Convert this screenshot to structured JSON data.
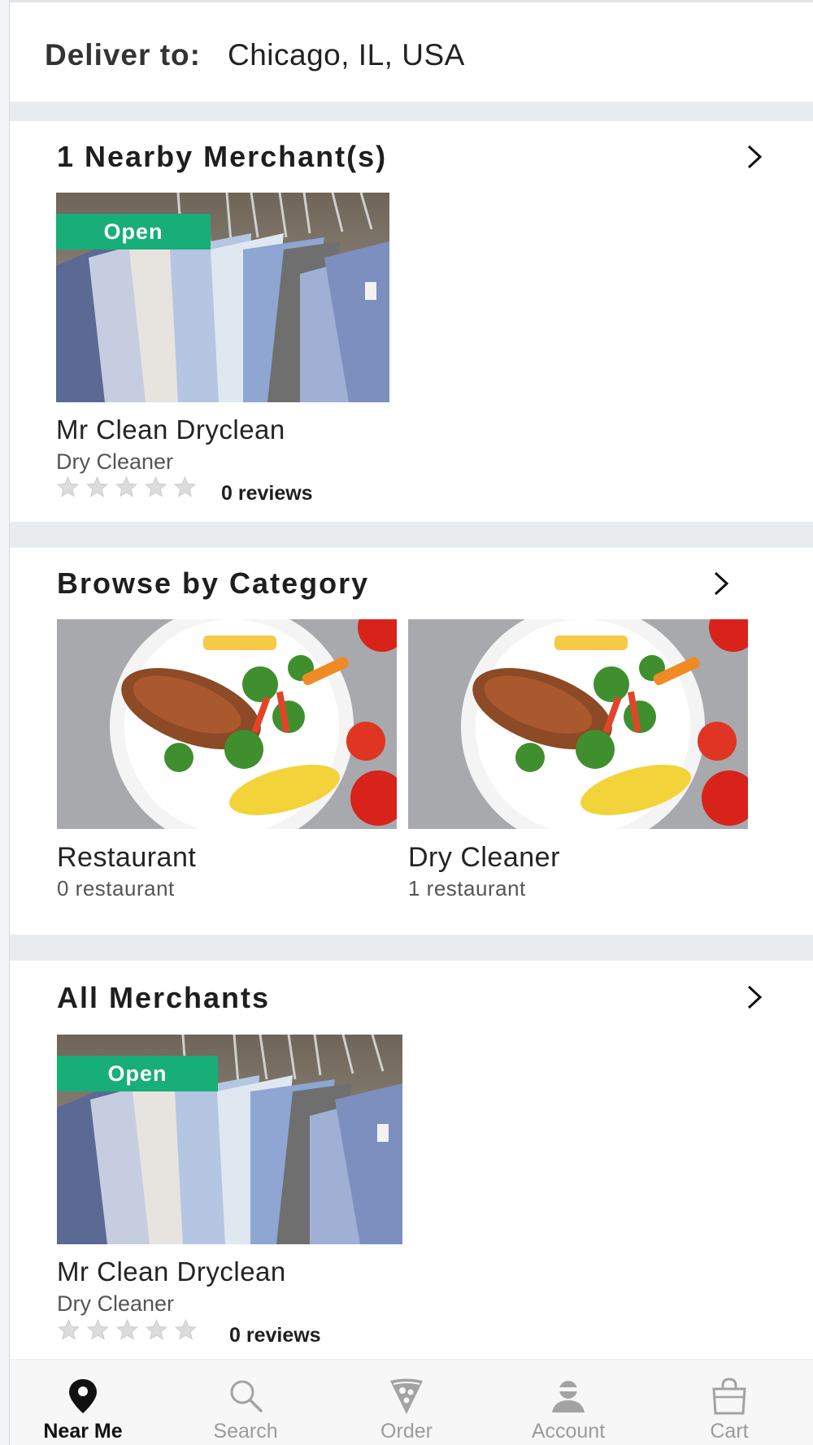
{
  "header": {
    "deliver_label": "Deliver to:",
    "location": "Chicago, IL, USA"
  },
  "nearby": {
    "title": "1 Nearby Merchant(s)",
    "merchant": {
      "badge": "Open",
      "name": "Mr Clean Dryclean",
      "category": "Dry Cleaner",
      "rating": 0,
      "reviews": "0 reviews"
    }
  },
  "categories": {
    "title": "Browse by Category",
    "items": [
      {
        "name": "Restaurant",
        "count": "0 restaurant"
      },
      {
        "name": "Dry Cleaner",
        "count": "1 restaurant"
      }
    ]
  },
  "all": {
    "title": "All Merchants",
    "merchant": {
      "badge": "Open",
      "name": "Mr Clean Dryclean",
      "category": "Dry Cleaner",
      "rating": 0,
      "reviews": "0 reviews"
    }
  },
  "nav": {
    "items": [
      {
        "label": "Near Me",
        "icon": "map-pin-icon",
        "active": true
      },
      {
        "label": "Search",
        "icon": "search-icon",
        "active": false
      },
      {
        "label": "Order",
        "icon": "pizza-icon",
        "active": false
      },
      {
        "label": "Account",
        "icon": "account-icon",
        "active": false
      },
      {
        "label": "Cart",
        "icon": "bag-icon",
        "active": false
      }
    ]
  },
  "colors": {
    "open_badge": "#17ae78",
    "separator": "#e8ecef",
    "nav_active": "#111111",
    "nav_inactive": "#9b9b9b"
  }
}
